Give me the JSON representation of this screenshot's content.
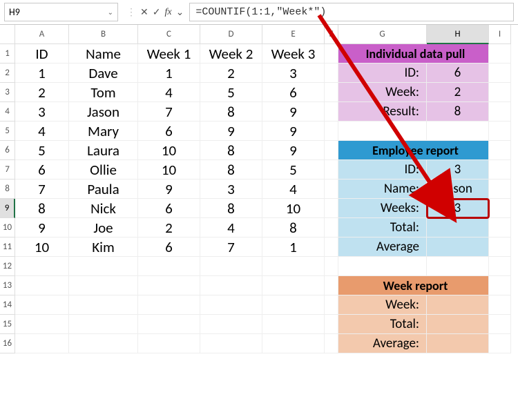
{
  "nameBox": "H9",
  "formula": "=COUNTIF(1:1,\"Week*\")",
  "columns": [
    "A",
    "B",
    "C",
    "D",
    "E",
    "F",
    "G",
    "H",
    "I"
  ],
  "rows": [
    "1",
    "2",
    "3",
    "4",
    "5",
    "6",
    "7",
    "8",
    "9",
    "10",
    "11",
    "12",
    "13",
    "14",
    "15",
    "16"
  ],
  "selectedCol": "H",
  "selectedRow": "9",
  "table": {
    "headers": {
      "id": "ID",
      "name": "Name",
      "w1": "Week 1",
      "w2": "Week 2",
      "w3": "Week 3"
    },
    "rows": [
      {
        "id": "1",
        "name": "Dave",
        "w1": "1",
        "w2": "2",
        "w3": "3"
      },
      {
        "id": "2",
        "name": "Tom",
        "w1": "4",
        "w2": "5",
        "w3": "6"
      },
      {
        "id": "3",
        "name": "Jason",
        "w1": "7",
        "w2": "8",
        "w3": "9"
      },
      {
        "id": "4",
        "name": "Mary",
        "w1": "6",
        "w2": "9",
        "w3": "9"
      },
      {
        "id": "5",
        "name": "Laura",
        "w1": "10",
        "w2": "8",
        "w3": "9"
      },
      {
        "id": "6",
        "name": "Ollie",
        "w1": "10",
        "w2": "8",
        "w3": "5"
      },
      {
        "id": "7",
        "name": "Paula",
        "w1": "9",
        "w2": "3",
        "w3": "4"
      },
      {
        "id": "8",
        "name": "Nick",
        "w1": "6",
        "w2": "8",
        "w3": "10"
      },
      {
        "id": "9",
        "name": "Joe",
        "w1": "2",
        "w2": "4",
        "w3": "8"
      },
      {
        "id": "10",
        "name": "Kim",
        "w1": "6",
        "w2": "7",
        "w3": "1"
      }
    ]
  },
  "indiv": {
    "title": "Individual data pull",
    "idLabel": "ID:",
    "idVal": "6",
    "weekLabel": "Week:",
    "weekVal": "2",
    "resultLabel": "Result:",
    "resultVal": "8"
  },
  "emp": {
    "title": "Employee report",
    "idLabel": "ID:",
    "idVal": "3",
    "nameLabel": "Name:",
    "nameVal": "Jason",
    "weeksLabel": "Weeks:",
    "weeksVal": "3",
    "totalLabel": "Total:",
    "totalVal": "",
    "avgLabel": "Average",
    "avgVal": ""
  },
  "week": {
    "title": "Week report",
    "weekLabel": "Week:",
    "weekVal": "",
    "totalLabel": "Total:",
    "totalVal": "",
    "avgLabel": "Average:",
    "avgVal": ""
  },
  "icons": {
    "check": "✓",
    "cross": "✕",
    "chev": "⌄"
  }
}
